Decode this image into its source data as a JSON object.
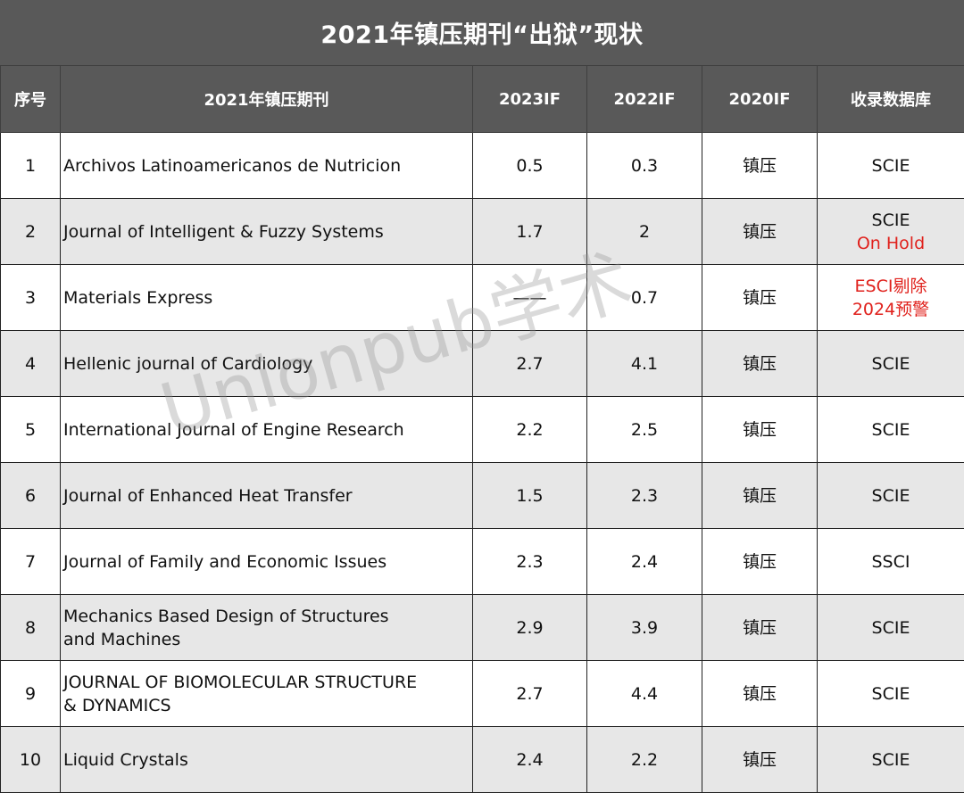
{
  "title": "2021年镇压期刊“出狱”现状",
  "headers": {
    "index": "序号",
    "journal": "2021年镇压期刊",
    "if2023": "2023IF",
    "if2022": "2022IF",
    "if2020": "2020IF",
    "database": "收录数据库"
  },
  "rows": [
    {
      "index": "1",
      "journal_line1": "Archivos Latinoamericanos de Nutricion",
      "journal_line2": "",
      "if2023": "0.5",
      "if2022": "0.3",
      "if2020": "镇压",
      "db_line1": "SCIE",
      "db_line2": ""
    },
    {
      "index": "2",
      "journal_line1": "Journal of Intelligent & Fuzzy Systems",
      "journal_line2": "",
      "if2023": "1.7",
      "if2022": "2",
      "if2020": "镇压",
      "db_line1": "SCIE",
      "db_line2": "On Hold"
    },
    {
      "index": "3",
      "journal_line1": "Materials Express",
      "journal_line2": "",
      "if2023": "——",
      "if2022": "0.7",
      "if2020": "镇压",
      "db_line1": "ESCI剔除",
      "db_line2": "2024预警"
    },
    {
      "index": "4",
      "journal_line1": "Hellenic journal of Cardiology",
      "journal_line2": "",
      "if2023": "2.7",
      "if2022": "4.1",
      "if2020": "镇压",
      "db_line1": "SCIE",
      "db_line2": ""
    },
    {
      "index": "5",
      "journal_line1": "International Journal of Engine Research",
      "journal_line2": "",
      "if2023": "2.2",
      "if2022": "2.5",
      "if2020": "镇压",
      "db_line1": "SCIE",
      "db_line2": ""
    },
    {
      "index": "6",
      "journal_line1": "Journal of Enhanced Heat Transfer",
      "journal_line2": "",
      "if2023": "1.5",
      "if2022": "2.3",
      "if2020": "镇压",
      "db_line1": "SCIE",
      "db_line2": ""
    },
    {
      "index": "7",
      "journal_line1": "Journal of Family and Economic Issues",
      "journal_line2": "",
      "if2023": "2.3",
      "if2022": "2.4",
      "if2020": "镇压",
      "db_line1": "SSCI",
      "db_line2": ""
    },
    {
      "index": "8",
      "journal_line1": "Mechanics Based Design of Structures",
      "journal_line2": "and Machines",
      "if2023": "2.9",
      "if2022": "3.9",
      "if2020": "镇压",
      "db_line1": "SCIE",
      "db_line2": ""
    },
    {
      "index": "9",
      "journal_line1": "JOURNAL OF BIOMOLECULAR STRUCTURE",
      "journal_line2": "& DYNAMICS",
      "if2023": "2.7",
      "if2022": "4.4",
      "if2020": "镇压",
      "db_line1": "SCIE",
      "db_line2": ""
    },
    {
      "index": "10",
      "journal_line1": "Liquid Crystals",
      "journal_line2": "",
      "if2023": "2.4",
      "if2022": "2.2",
      "if2020": "镇压",
      "db_line1": "SCIE",
      "db_line2": ""
    }
  ],
  "watermark": "Unionpub学术",
  "colors": {
    "header_bg": "#595959",
    "row_alt_bg": "#e7e7e7",
    "highlight_red": "#e0211c"
  }
}
